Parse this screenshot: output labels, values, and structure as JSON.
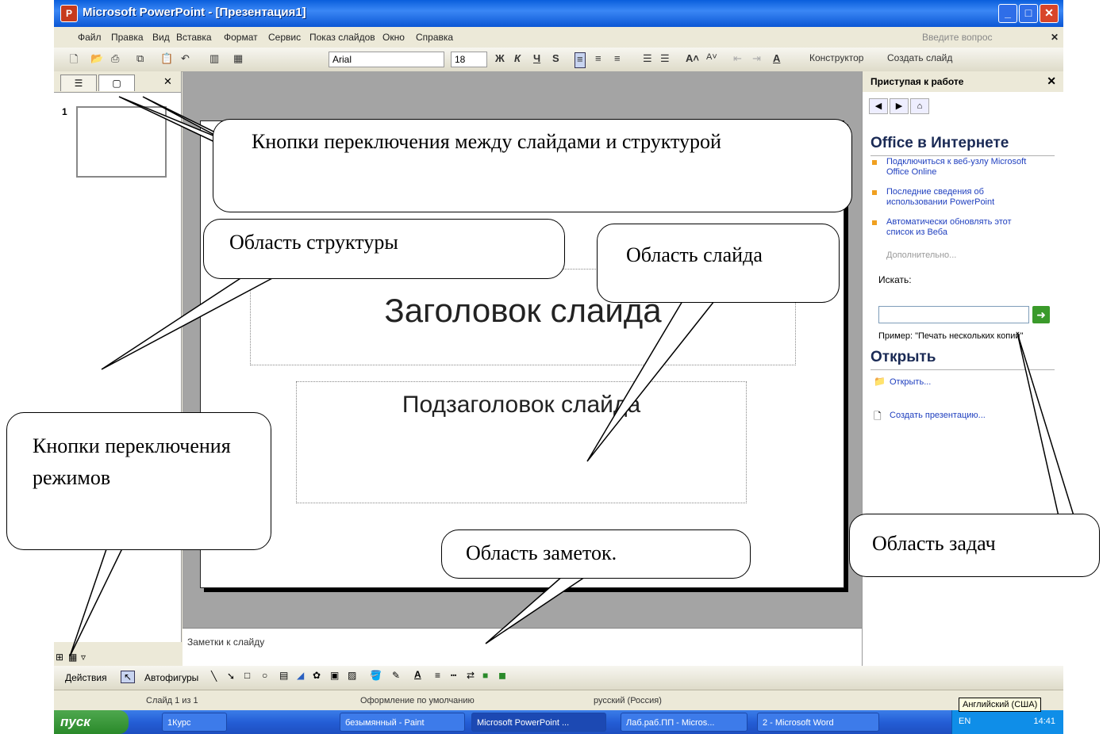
{
  "window": {
    "title": "Microsoft PowerPoint - [Презентация1]",
    "min": "_",
    "max": "□",
    "close": "✕"
  },
  "menu": [
    "Файл",
    "Правка",
    "Вид",
    "Вставка",
    "Формат",
    "Сервис",
    "Показ слайдов",
    "Окно",
    "Справка"
  ],
  "help_placeholder": "Введите вопрос",
  "toolbar": {
    "font_name": "Arial",
    "font_size": "18",
    "bold": "Ж",
    "italic": "К",
    "underline": "Ч",
    "shadow": "S",
    "designer": "Конструктор",
    "new_slide": "Создать слайд"
  },
  "outline_tabs": [
    "☰",
    "▢"
  ],
  "slide_number": "1",
  "slide": {
    "title": "Заголовок слайда",
    "subtitle": "Подзаголовок слайда"
  },
  "notes_placeholder": "Заметки к слайду",
  "task_pane": {
    "header": "Приступая к работе",
    "office_section": "Office в Интернете",
    "links": [
      "Подключиться к веб-узлу Microsoft Office Online",
      "Последние сведения об использовании PowerPoint",
      "Автоматически обновлять этот список из Веба"
    ],
    "more": "Дополнительно...",
    "search_label": "Искать:",
    "example": "Пример: \"Печать нескольких копий\"",
    "open_section": "Открыть",
    "open_link": "Открыть...",
    "create_link": "Создать презентацию..."
  },
  "drawing": {
    "actions": "Действия",
    "autoshapes": "Автофигуры"
  },
  "status": {
    "slide": "Слайд 1 из 1",
    "design": "Оформление по умолчанию",
    "language": "русский (Россия)"
  },
  "language_tooltip": "Английский (США)",
  "taskbar": {
    "start": "пуск",
    "items": [
      "1Курс",
      "безымянный - Paint",
      "Microsoft PowerPoint ...",
      "Лаб.раб.ПП - Micros...",
      "2 - Microsoft Word"
    ],
    "lang": "EN",
    "time": "14:41"
  },
  "callouts": {
    "switch_slides": "Кнопки переключения между слайдами и структурой",
    "outline_area": "Область структуры",
    "slide_area": "Область слайда",
    "view_buttons": "Кнопки переключения режимов",
    "notes_area": "Область заметок.",
    "task_area": "Область задач"
  }
}
